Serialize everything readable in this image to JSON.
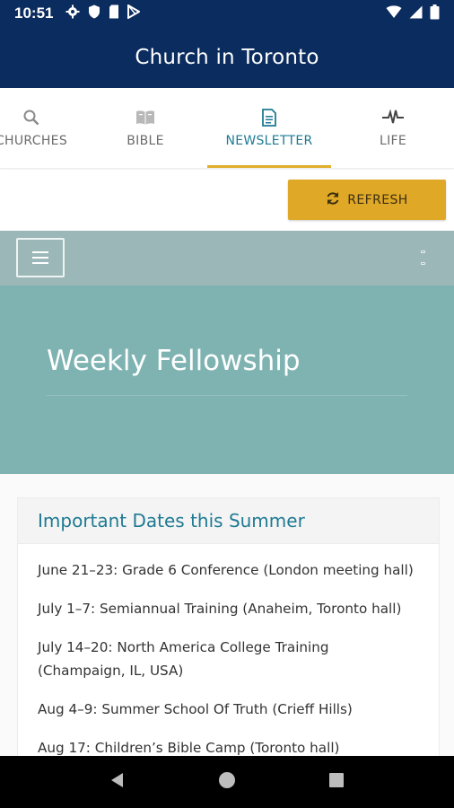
{
  "status_bar": {
    "time": "10:51",
    "left_icons": [
      "gear-icon",
      "shield-icon",
      "sim-card-icon",
      "play-store-icon"
    ],
    "right_icons": [
      "wifi-icon",
      "signal-icon",
      "battery-icon"
    ]
  },
  "app_bar": {
    "title": "Church in Toronto"
  },
  "tabs": [
    {
      "label": "CHURCHES",
      "icon": "search-icon",
      "active": false
    },
    {
      "label": "BIBLE",
      "icon": "book-icon",
      "active": false
    },
    {
      "label": "NEWSLETTER",
      "icon": "document-icon",
      "active": true
    },
    {
      "label": "LIFE",
      "icon": "pulse-icon",
      "active": false
    }
  ],
  "refresh": {
    "label": "REFRESH",
    "icon": "refresh-icon"
  },
  "web": {
    "menu_icon": "hamburger-icon",
    "hero_title": "Weekly Fellowship",
    "section_title": "Important Dates this Summer",
    "dates": [
      "June 21–23: Grade 6 Conference (London meeting hall)",
      "July 1–7: Semiannual Training (Anaheim, Toronto hall)",
      "July 14–20: North America College Training (Champaign, IL, USA)",
      "Aug 4–9: Summer School Of Truth (Crieff Hills)",
      "Aug 17: Children’s Bible Camp (Toronto hall)"
    ]
  },
  "colors": {
    "primary": "#0b2c5e",
    "accent": "#dfa826",
    "tab_active": "#1f7a93",
    "hero": "#7fb3b2",
    "web_nav": "#9cb7b7"
  }
}
